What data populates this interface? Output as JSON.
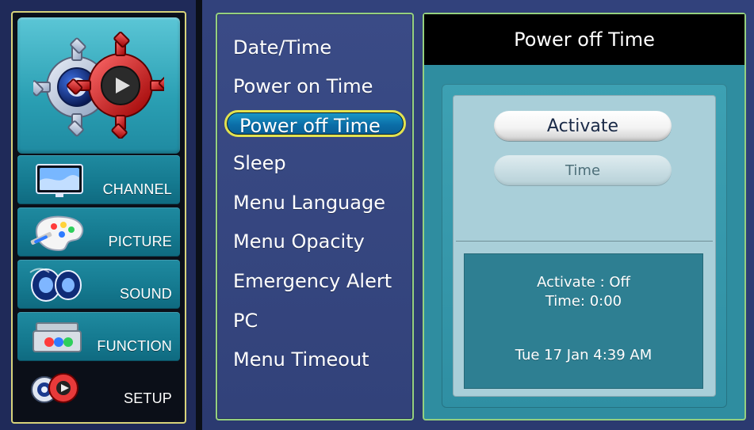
{
  "left_nav": {
    "items": [
      {
        "label": "CHANNEL",
        "icon": "tv-icon"
      },
      {
        "label": "PICTURE",
        "icon": "palette-icon"
      },
      {
        "label": "SOUND",
        "icon": "speaker-icon"
      },
      {
        "label": "FUNCTION",
        "icon": "toolbox-icon"
      },
      {
        "label": "SETUP",
        "icon": "gears-icon",
        "active": true
      }
    ]
  },
  "setup_menu": {
    "items": [
      "Date/Time",
      "Power on Time",
      "Power off Time",
      "Sleep",
      "Menu Language",
      "Menu Opacity",
      "Emergency Alert",
      "PC",
      "Menu Timeout"
    ],
    "selected_index": 2
  },
  "details": {
    "title": "Power off Time",
    "buttons": {
      "activate": "Activate",
      "time": "Time"
    },
    "status": {
      "activate": "Activate : Off",
      "time": "Time: 0:00",
      "datetime": "Tue 17 Jan 4:39 AM"
    }
  },
  "colors": {
    "panel_border": "#95d07f",
    "left_border": "#d8d37a",
    "selected_outline": "#e2e24e",
    "selected_fill": "#0b6ea8"
  }
}
